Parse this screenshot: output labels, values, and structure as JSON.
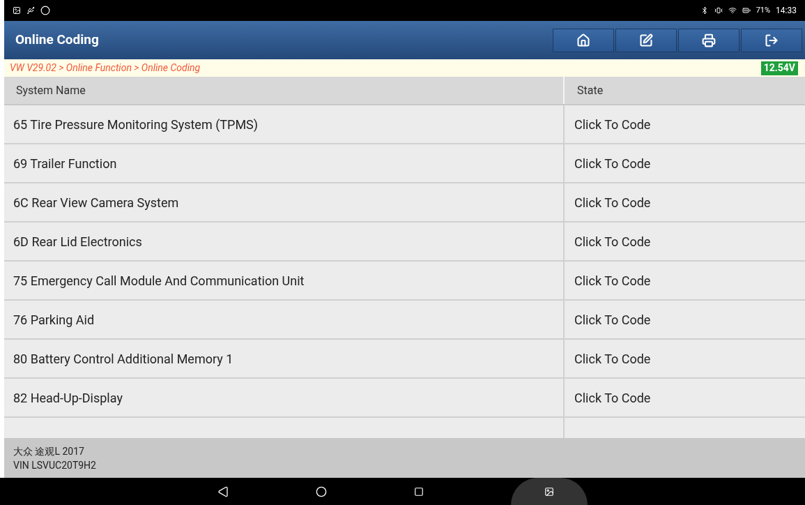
{
  "status_bar": {
    "battery": "71%",
    "time": "14:33"
  },
  "header": {
    "title": "Online Coding"
  },
  "breadcrumb": {
    "path": "VW V29.02 > Online Function > Online Coding",
    "voltage": "12.54V"
  },
  "table": {
    "columns": [
      "System Name",
      "State"
    ],
    "rows": [
      {
        "name": "65 Tire Pressure Monitoring System (TPMS)",
        "state": "Click To Code"
      },
      {
        "name": "69 Trailer Function",
        "state": "Click To Code"
      },
      {
        "name": "6C Rear View Camera System",
        "state": "Click To Code"
      },
      {
        "name": "6D Rear Lid Electronics",
        "state": "Click To Code"
      },
      {
        "name": "75 Emergency Call Module And Communication Unit",
        "state": "Click To Code"
      },
      {
        "name": "76 Parking Aid",
        "state": "Click To Code"
      },
      {
        "name": "80 Battery Control Additional Memory 1",
        "state": "Click To Code"
      },
      {
        "name": "82 Head-Up-Display",
        "state": "Click To Code"
      }
    ]
  },
  "footer": {
    "vehicle": "大众 途观L 2017",
    "vin": "VIN LSVUC20T9H2"
  }
}
